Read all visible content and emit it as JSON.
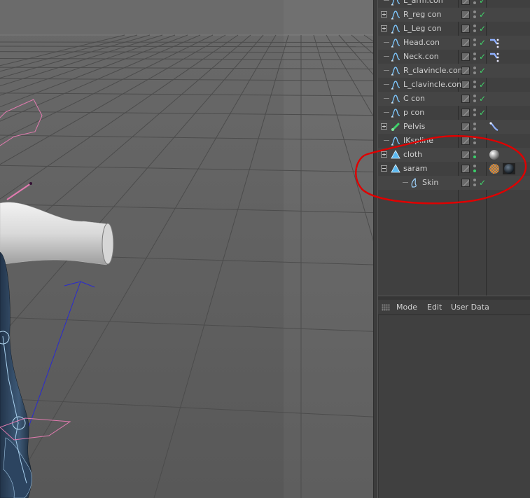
{
  "object_manager": {
    "rows": [
      {
        "label": "L_arm.con",
        "icon": "spline-icon",
        "depth": 1,
        "expander": "none",
        "check": true,
        "tag": "none"
      },
      {
        "label": "R_reg con",
        "icon": "spline-icon",
        "depth": 1,
        "expander": "plus",
        "check": true,
        "tag": "none"
      },
      {
        "label": "L_Leg con",
        "icon": "spline-icon",
        "depth": 1,
        "expander": "plus",
        "check": true,
        "tag": "none"
      },
      {
        "label": "Head.con",
        "icon": "spline-icon",
        "depth": 1,
        "expander": "none",
        "check": true,
        "tag": "constraint-tag-icon"
      },
      {
        "label": "Neck.con",
        "icon": "spline-icon",
        "depth": 1,
        "expander": "none",
        "check": true,
        "tag": "constraint-tag-icon"
      },
      {
        "label": "R_clavincle.con",
        "icon": "spline-icon",
        "depth": 1,
        "expander": "none",
        "check": true,
        "tag": "none"
      },
      {
        "label": "L_clavincle.con",
        "icon": "spline-icon",
        "depth": 1,
        "expander": "none",
        "check": true,
        "tag": "none"
      },
      {
        "label": "C con",
        "icon": "spline-icon",
        "depth": 1,
        "expander": "none",
        "check": true,
        "tag": "none"
      },
      {
        "label": "p con",
        "icon": "spline-icon",
        "depth": 1,
        "expander": "none",
        "check": true,
        "tag": "none"
      },
      {
        "label": "Pelvis",
        "icon": "joint-icon",
        "depth": 1,
        "expander": "plus",
        "check": false,
        "tag": "ik-tag-icon"
      },
      {
        "label": "IKspline",
        "icon": "spline-icon",
        "depth": 1,
        "expander": "none",
        "check": false,
        "tag": "none"
      },
      {
        "label": "cloth",
        "icon": "polygon-object-icon",
        "depth": 1,
        "expander": "plus",
        "check": false,
        "tag": "material-tag-icon"
      },
      {
        "label": "saram",
        "icon": "polygon-object-icon",
        "depth": 1,
        "expander": "minus",
        "check": false,
        "tag": "material-tags-icon"
      },
      {
        "label": "Skin",
        "icon": "skin-deformer-icon",
        "depth": 2,
        "expander": "none",
        "check": true,
        "tag": "none"
      }
    ]
  },
  "attribute_manager": {
    "menu": {
      "mode": "Mode",
      "edit": "Edit",
      "user_data": "User Data"
    }
  },
  "colors": {
    "check": "#41d36b",
    "annotation": "#e00000",
    "viewport_bg": "#5e5e5e",
    "panel_bg": "#404040"
  }
}
